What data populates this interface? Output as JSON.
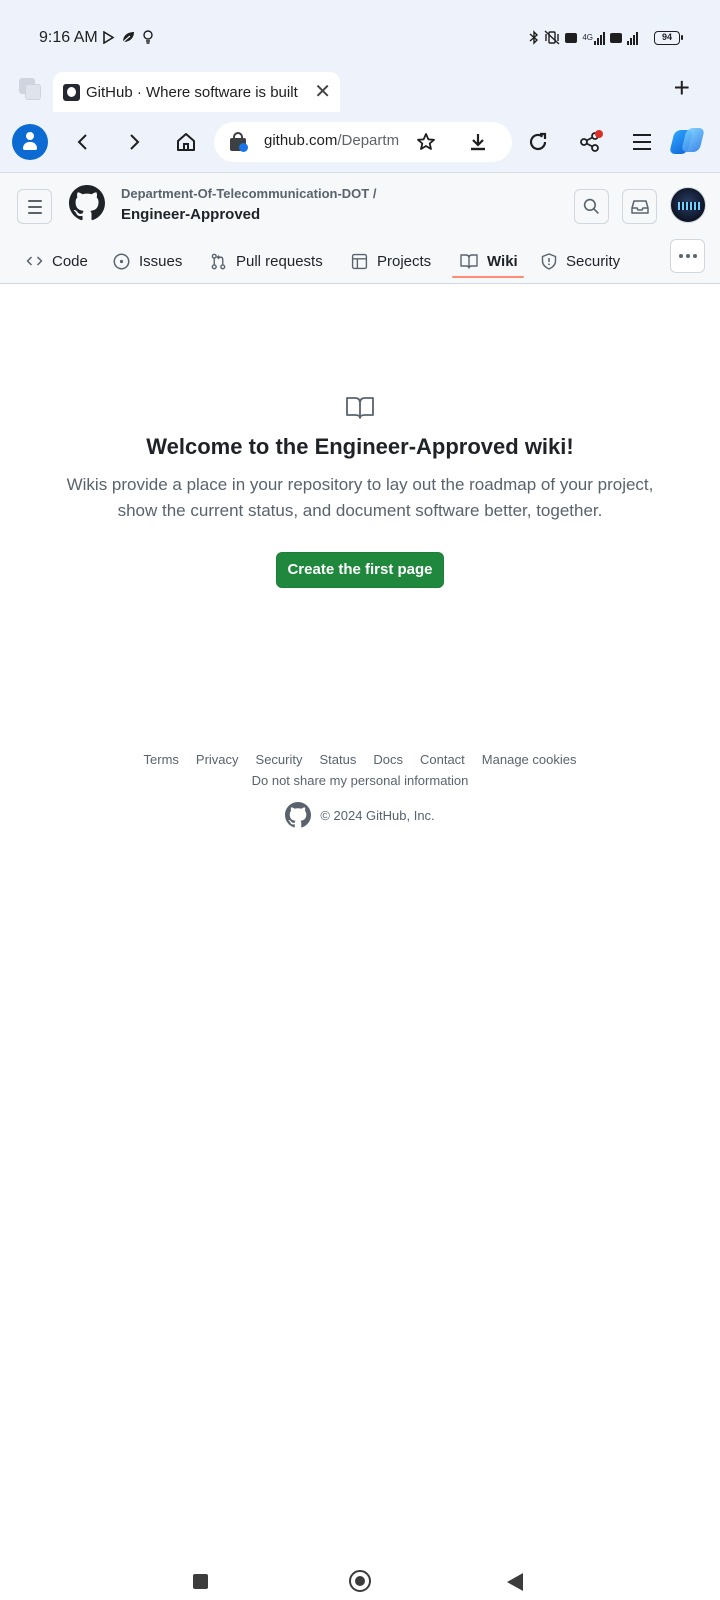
{
  "status_bar": {
    "time": "9:16 AM",
    "battery": "94",
    "network": "4G",
    "icons": [
      "play-icon",
      "leaf-icon",
      "bulb-icon",
      "bluetooth-icon",
      "vibrate-off-icon",
      "volte-icon",
      "signal-icon",
      "battery-icon"
    ]
  },
  "browser": {
    "tab_title": "GitHub · Where software is built",
    "url_host": "github.com",
    "url_path": "/Departm",
    "icons": [
      "profile-icon",
      "back-icon",
      "forward-icon",
      "home-icon",
      "star-icon",
      "download-icon",
      "reload-icon",
      "share-icon",
      "menu-icon",
      "copilot-icon"
    ]
  },
  "github": {
    "owner": "Department-Of-Telecommunication-DOT /",
    "repo": "Engineer-Approved",
    "nav": [
      {
        "label": "Code",
        "icon": "code-icon"
      },
      {
        "label": "Issues",
        "icon": "issue-icon"
      },
      {
        "label": "Pull requests",
        "icon": "pull-request-icon"
      },
      {
        "label": "Projects",
        "icon": "table-icon"
      },
      {
        "label": "Wiki",
        "icon": "book-icon",
        "active": true
      },
      {
        "label": "Security",
        "icon": "shield-icon"
      }
    ],
    "accent": "#fd8c73",
    "primary_button_color": "#1f883d"
  },
  "blankslate": {
    "title": "Welcome to the Engineer-Approved wiki!",
    "description": "Wikis provide a place in your repository to lay out the roadmap of your project, show the current status, and document software better, together.",
    "button": "Create the first page"
  },
  "footer": {
    "links": [
      "Terms",
      "Privacy",
      "Security",
      "Status",
      "Docs",
      "Contact",
      "Manage cookies"
    ],
    "dns": "Do not share my personal information",
    "copyright": "© 2024 GitHub, Inc."
  }
}
